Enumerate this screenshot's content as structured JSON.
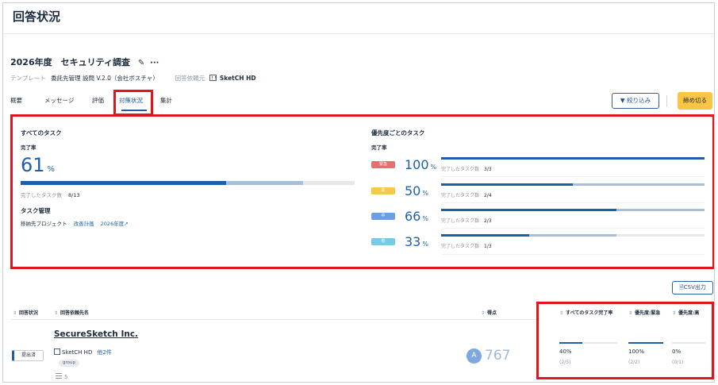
{
  "page": {
    "title": "回答状況"
  },
  "survey": {
    "title": "2026年度　セキュリティ調査",
    "template_label": "テンプレート",
    "template_value": "委託先管理 設問 V.2.0（会社ボスチャ）",
    "requester_label": "回答依頼元",
    "requester_value": "SketCH HD"
  },
  "tabs": [
    {
      "label": "概要"
    },
    {
      "label": "メッセージ"
    },
    {
      "label": "評価"
    },
    {
      "label": "対策状況"
    },
    {
      "label": "集計"
    }
  ],
  "toolbar": {
    "filter_label": "絞り込み",
    "close_label": "締め切る",
    "csv_label": "CSV出力"
  },
  "all_tasks": {
    "title": "すべてのタスク",
    "rate_label": "完了率",
    "rate_value": "61",
    "unit": "%",
    "progress": 0.615,
    "secondary_progress": 0.845,
    "done_label": "完了したタスク数",
    "done_value": "8/13",
    "mgmt_title": "タスク管理",
    "mgmt_text": "移納先プロジェクト",
    "mgmt_link1": "改善計画",
    "mgmt_link2": "2026年度"
  },
  "priority": {
    "title": "優先度ごとのタスク",
    "rate_label": "完了率",
    "rows": [
      {
        "badge": "緊急",
        "badge_color": "#e86f6f",
        "pct": "100",
        "progress": 1.0,
        "secondary": 1.0,
        "done_label": "完了したタスク数",
        "done_value": "3/3"
      },
      {
        "badge": "高",
        "badge_color": "#f4c94a",
        "pct": "50",
        "progress": 0.5,
        "secondary": 1.0,
        "done_label": "完了したタスク数",
        "done_value": "2/4"
      },
      {
        "badge": "中",
        "badge_color": "#6c9fe0",
        "pct": "66",
        "progress": 0.667,
        "secondary": 1.0,
        "done_label": "完了したタスク数",
        "done_value": "2/3"
      },
      {
        "badge": "低",
        "badge_color": "#79c9e8",
        "pct": "33",
        "progress": 0.333,
        "secondary": 0.667,
        "done_label": "完了したタスク数",
        "done_value": "1/3"
      }
    ]
  },
  "table": {
    "headers": {
      "status": "回答状況",
      "vendor": "回答依頼先名",
      "score": "得点",
      "all_rate": "すべてのタスク完了率",
      "urgent": "優先度:緊急",
      "high": "優先度:高"
    },
    "row": {
      "status": "提出済",
      "vendor_name": "SecureSketch Inc.",
      "vendor_org": "SketCH HD",
      "others": "他2件",
      "group": "group",
      "list_count": "5",
      "grade": "A",
      "score": "767",
      "all_rate": "40%",
      "all_frac": "(2/5)",
      "all_progress": 0.4,
      "urgent_rate": "100%",
      "urgent_frac": "(2/2)",
      "urgent_progress": 1.0,
      "high_rate": "0%",
      "high_frac": "(0/1)",
      "high_progress": 0.0
    }
  },
  "colors": {
    "accent": "#1f5ea8",
    "highlight_box": "#e4141b",
    "close_button": "#f8c545"
  }
}
